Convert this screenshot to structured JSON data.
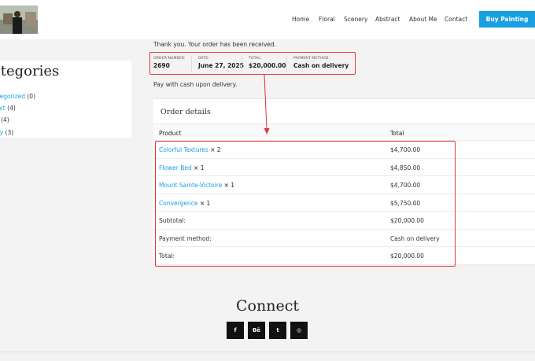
{
  "nav": {
    "items": [
      "Home",
      "Floral",
      "Scenery",
      "Abstract",
      "About Me",
      "Contact"
    ],
    "cta": "Buy Painting"
  },
  "notice": "Thank you. Your order has been received.",
  "summary": {
    "order_number_label": "ORDER NUMBER:",
    "order_number": "2690",
    "date_label": "DATE:",
    "date": "June 27, 2025",
    "total_label": "TOTAL:",
    "total": "$20,000.00",
    "payment_label": "PAYMENT METHOD:",
    "payment": "Cash on delivery"
  },
  "pay_note": "Pay with cash upon delivery.",
  "categories": {
    "title": "ategories",
    "items": [
      {
        "name": "ategorized",
        "count": "(0)"
      },
      {
        "name": "ract",
        "count": "(4)"
      },
      {
        "name": "al",
        "count": "(4)"
      },
      {
        "name": "ery",
        "count": "(3)"
      }
    ]
  },
  "order": {
    "title": "Order details",
    "col_product": "Product",
    "col_total": "Total",
    "items": [
      {
        "name": "Colorful Textures",
        "qty": "× 2",
        "total": "$4,700.00"
      },
      {
        "name": "Flower Bed",
        "qty": "× 1",
        "total": "$4,850.00"
      },
      {
        "name": "Mount Sainte-Victoire",
        "qty": "× 1",
        "total": "$4,700.00"
      },
      {
        "name": "Convergence",
        "qty": "× 1",
        "total": "$5,750.00"
      }
    ],
    "subtotal_label": "Subtotal:",
    "subtotal": "$20,000.00",
    "payment_label": "Payment method:",
    "payment": "Cash on delivery",
    "total_label": "Total:",
    "total": "$20,000.00"
  },
  "footer": {
    "connect": "Connect",
    "socials": [
      {
        "icon": "facebook-icon",
        "glyph": "f"
      },
      {
        "icon": "behance-icon",
        "glyph": "Bē"
      },
      {
        "icon": "twitter-icon",
        "glyph": "t"
      },
      {
        "icon": "instagram-icon",
        "glyph": "◎"
      }
    ]
  },
  "colors": {
    "accent": "#18a0e3",
    "highlight": "#e5343a"
  }
}
